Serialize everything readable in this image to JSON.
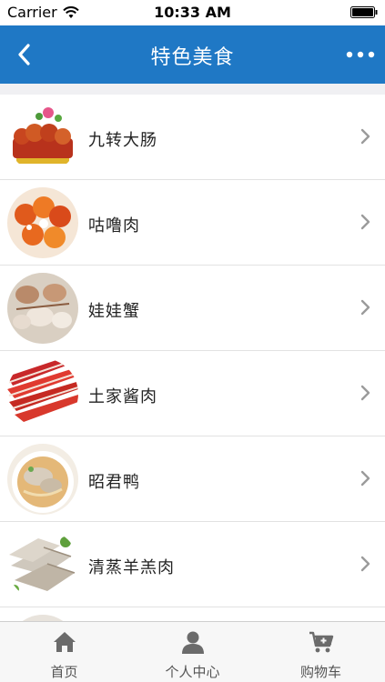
{
  "status_bar": {
    "carrier": "Carrier",
    "time": "10:33 AM"
  },
  "nav": {
    "title": "特色美食",
    "bar_color": "#1f78c5"
  },
  "list": {
    "items": [
      {
        "label": "九转大肠"
      },
      {
        "label": "咕噜肉"
      },
      {
        "label": "娃娃蟹"
      },
      {
        "label": "土家酱肉"
      },
      {
        "label": "昭君鸭"
      },
      {
        "label": "清蒸羊羔肉"
      }
    ]
  },
  "tab_bar": {
    "tabs": [
      {
        "label": "首页",
        "icon": "home-icon"
      },
      {
        "label": "个人中心",
        "icon": "user-icon"
      },
      {
        "label": "购物车",
        "icon": "cart-icon"
      }
    ]
  }
}
